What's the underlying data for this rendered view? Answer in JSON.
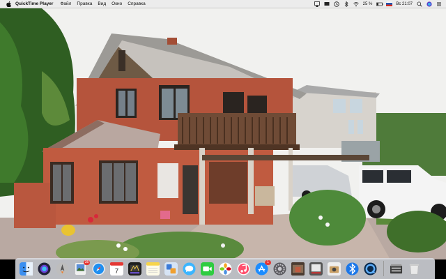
{
  "menubar": {
    "app_name": "QuickTime Player",
    "menus": [
      "Файл",
      "Правка",
      "Вид",
      "Окно",
      "Справка"
    ],
    "battery_text": "25 %",
    "clock": "Вс 21:07"
  },
  "dock": {
    "items": [
      {
        "icon": "finder-icon",
        "color": "#3b8ff0"
      },
      {
        "icon": "siri-icon",
        "color": "#6a3fd6"
      },
      {
        "icon": "launchpad-icon",
        "color": "#8a8a8a"
      },
      {
        "icon": "preview-icon",
        "color": "#5a8fd8",
        "badge": "35"
      },
      {
        "icon": "safari-icon",
        "color": "#1f8ff0"
      },
      {
        "icon": "calendar-icon",
        "color": "#ffffff",
        "label": "7"
      },
      {
        "icon": "final-cut-icon",
        "color": "#222222"
      },
      {
        "icon": "notes-icon",
        "color": "#f7e36b"
      },
      {
        "icon": "app-store-tools-icon",
        "color": "#3c7bd8"
      },
      {
        "icon": "messages-icon",
        "color": "#3bb5ff"
      },
      {
        "icon": "facetime-icon",
        "color": "#2ecc40"
      },
      {
        "icon": "photos-icon",
        "color": "#ffffff"
      },
      {
        "icon": "music-icon",
        "color": "#ff4f6d"
      },
      {
        "icon": "app-store-icon",
        "color": "#1a8cff",
        "badge": "1"
      },
      {
        "icon": "system-preferences-icon",
        "color": "#8e8e93"
      },
      {
        "icon": "quicktime-thumbnail-icon",
        "color": "#555555"
      },
      {
        "icon": "photo-booth-icon",
        "color": "#666666"
      },
      {
        "icon": "image-capture-icon",
        "color": "#c9a066"
      },
      {
        "icon": "bluetooth-icon",
        "color": "#1b77e8"
      },
      {
        "icon": "quicktime-icon",
        "color": "#0a4f8e"
      },
      {
        "icon": "downloads-stack-icon",
        "color": "#444444"
      },
      {
        "icon": "trash-icon",
        "color": "#e6e6e6"
      }
    ]
  }
}
